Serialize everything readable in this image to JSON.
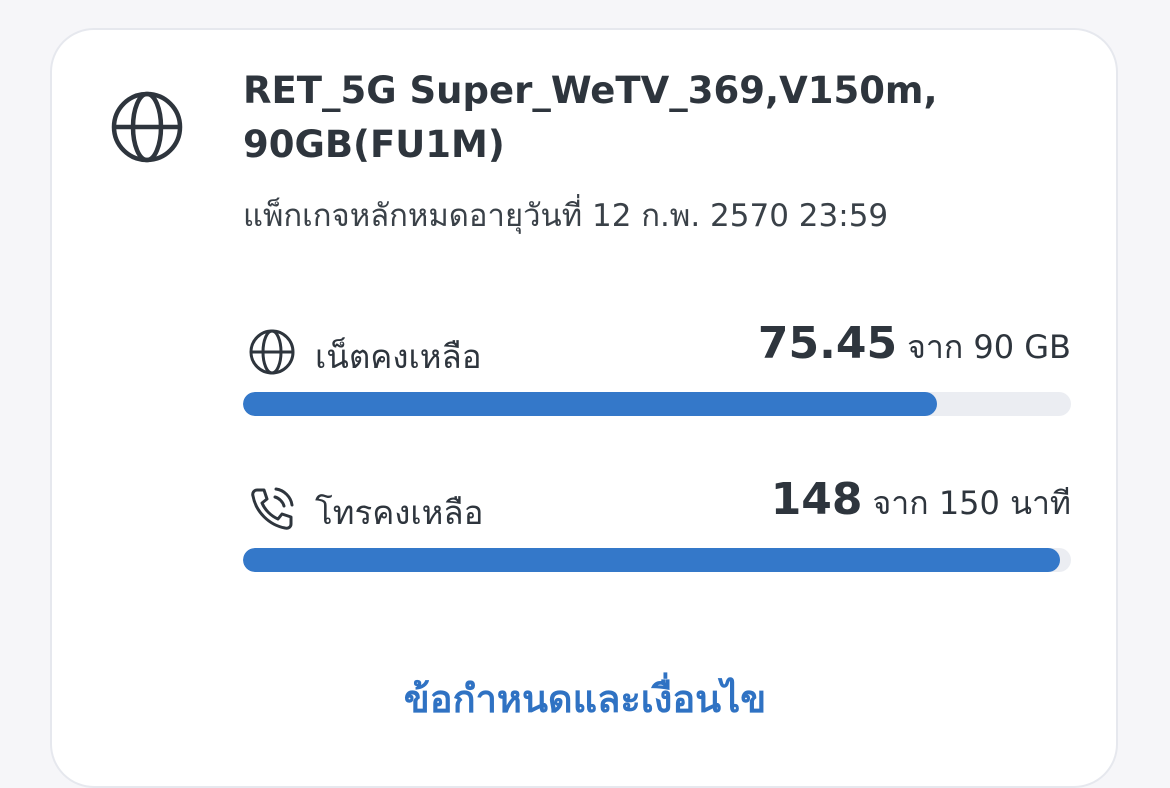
{
  "plan": {
    "icon": "globe-icon",
    "title": "RET_5G Super_WeTV_369,V150m, 90GB(FU1M)",
    "expiry": "แพ็กเกจหลักหมดอายุวันที่ 12 ก.พ. 2570 23:59"
  },
  "data_usage": {
    "icon": "globe-icon",
    "label": "เน็ตคงเหลือ",
    "remaining": "75.45",
    "total_text": "จาก 90 GB",
    "fraction": 0.8383
  },
  "voice_usage": {
    "icon": "phone-call-icon",
    "label": "โทรคงเหลือ",
    "remaining": "148",
    "total_text": "จาก 150 นาที",
    "fraction": 0.9867
  },
  "terms_link": "ข้อกำหนดและเงื่อนไข",
  "colors": {
    "accent": "#3478c9",
    "track": "#ebedf2",
    "link": "#2f72c3",
    "text": "#2e353d"
  }
}
